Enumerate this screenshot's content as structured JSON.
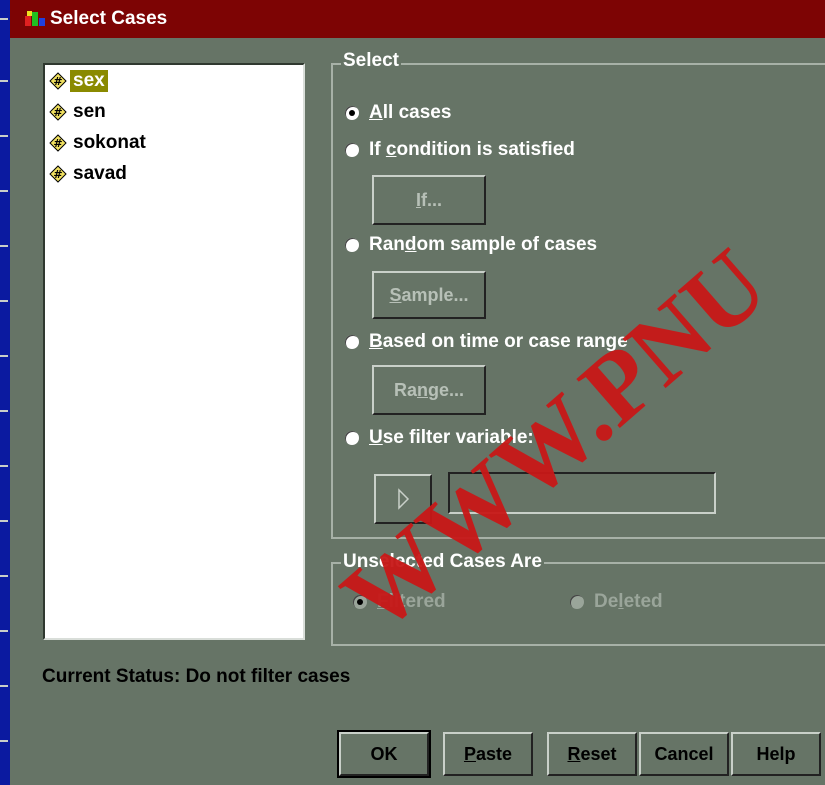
{
  "window": {
    "title": "Select Cases"
  },
  "variables": [
    {
      "name": "sex",
      "selected": true
    },
    {
      "name": "sen",
      "selected": false
    },
    {
      "name": "sokonat",
      "selected": false
    },
    {
      "name": "savad",
      "selected": false
    }
  ],
  "select_group": {
    "label": "Select",
    "options": {
      "all_cases": {
        "label": "All cases",
        "checked": true
      },
      "if_condition": {
        "label": "If condition is satisfied",
        "checked": false
      },
      "random_sample": {
        "label": "Random sample of cases",
        "checked": false
      },
      "time_range": {
        "label": "Based on time or case range",
        "checked": false
      },
      "filter_variable": {
        "label": "Use filter variable:",
        "checked": false
      }
    },
    "buttons": {
      "if": "If...",
      "sample": "Sample...",
      "range": "Range..."
    },
    "filter_variable_value": ""
  },
  "unselected_group": {
    "label": "Unselected Cases Are",
    "options": {
      "filtered": {
        "label": "Filtered",
        "checked": true
      },
      "deleted": {
        "label": "Deleted",
        "checked": false
      }
    }
  },
  "status": {
    "text": "Current Status: Do not filter cases"
  },
  "buttons": {
    "ok": "OK",
    "paste": "Paste",
    "reset": "Reset",
    "cancel": "Cancel",
    "help": "Help"
  },
  "watermark": "WWW.PNU",
  "icons": {
    "app": "spss-app-icon",
    "variable": "numeric-variable-icon",
    "move": "right-arrow-icon"
  },
  "colors": {
    "titlebar": "#7d0404",
    "dialog_bg": "#667466",
    "desktop": "#0b1aa0",
    "watermark": "#c81818"
  }
}
